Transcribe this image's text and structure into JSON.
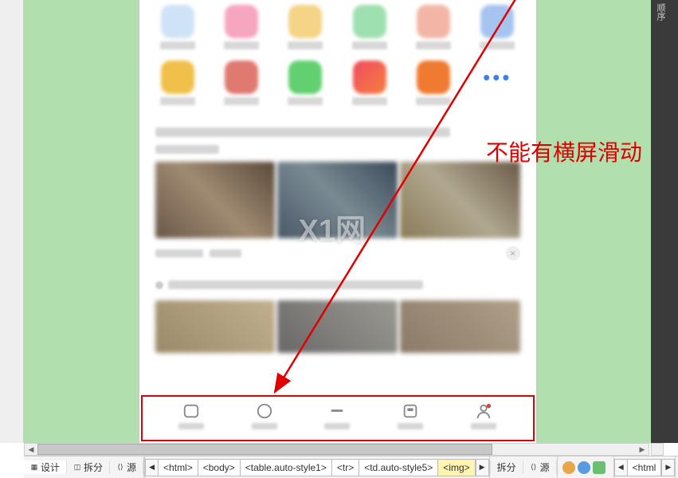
{
  "sidebar": {
    "label": "顺序"
  },
  "annotation": {
    "text": "不能有横屏滑动"
  },
  "icon_row1_colors": [
    "#cfe3f7",
    "#f7a6c0",
    "#f5d488",
    "#9fe0b0",
    "#f3b6a6",
    "#a6c4f0"
  ],
  "icon_row2_colors": [
    "#f0c04a",
    "#e07a70",
    "#62d070",
    "#f04a60",
    "#f07a30",
    "more"
  ],
  "more_glyph": "•••",
  "close_glyph": "×",
  "watermark": {
    "text": "X1网"
  },
  "status": {
    "tabs": [
      {
        "id": "design",
        "label": "设计",
        "active": true
      },
      {
        "id": "split",
        "label": "拆分",
        "active": false
      },
      {
        "id": "source",
        "label": "源",
        "active": false
      }
    ],
    "crumbs": [
      "<html>",
      "<body>",
      "<table.auto-style1>",
      "<tr>",
      "<td.auto-style5>",
      "<img>"
    ],
    "crumb_selected_index": 5,
    "right_tabs": [
      {
        "id": "split",
        "label": "拆分"
      },
      {
        "id": "source",
        "label": "源"
      }
    ],
    "right_crumbs": [
      "<html"
    ]
  }
}
